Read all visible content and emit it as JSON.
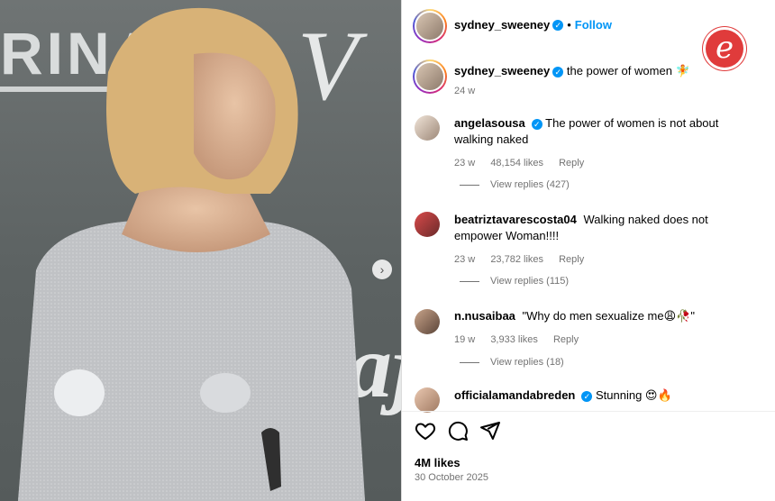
{
  "post": {
    "author": "sydney_sweeney",
    "follow_label": "Follow",
    "dot": "•",
    "verified_glyph": "✓"
  },
  "caption": {
    "author": "sydney_sweeney",
    "text": "the power of women 🧚",
    "age": "24 w"
  },
  "comments": [
    {
      "user": "angelasousa",
      "verified": true,
      "text": "The power of women is not about walking naked",
      "age": "23 w",
      "likes": "48,154 likes",
      "reply": "Reply",
      "view_replies": "View replies (427)"
    },
    {
      "user": "beatriztavarescosta04",
      "verified": false,
      "text": "Walking naked does not empower Woman!!!!",
      "age": "23 w",
      "likes": "23,782 likes",
      "reply": "Reply",
      "view_replies": "View replies (115)"
    },
    {
      "user": "n.nusaibaa",
      "verified": false,
      "text": "\"Why do men sexualize me😩🥀\"",
      "age": "19 w",
      "likes": "3,933 likes",
      "reply": "Reply",
      "view_replies": "View replies (18)"
    },
    {
      "user": "officialamandabreden",
      "verified": true,
      "text": "Stunning 😍🔥"
    }
  ],
  "footer": {
    "likes": "4M likes",
    "date": "30 October 2025"
  },
  "icons": {
    "like": "heart-icon",
    "comment": "comment-icon",
    "share": "share-icon",
    "next": "chevron-right-icon",
    "watermark": "e-logo"
  },
  "watermark_letter": "e",
  "next_glyph": "›",
  "backdrop_text": {
    "top": "RINA",
    "middle": "V",
    "right": "aj"
  },
  "colors": {
    "accent": "#0095f6",
    "muted": "#737373",
    "badge": "#e03b3b"
  }
}
